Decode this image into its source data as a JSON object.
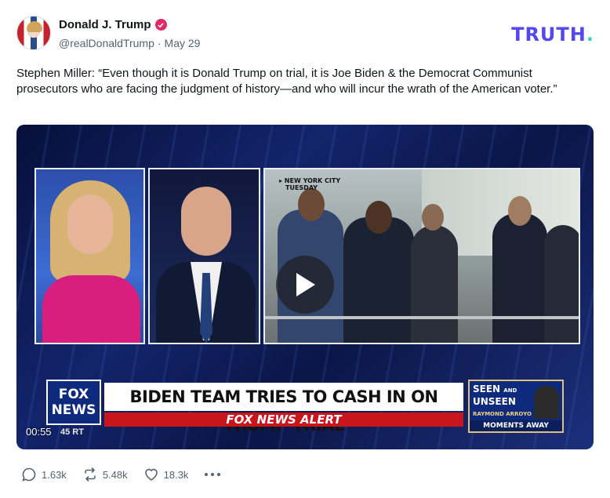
{
  "post": {
    "author": {
      "display_name": "Donald J. Trump",
      "handle": "@realDonaldTrump",
      "separator": "·",
      "date": "May 29",
      "verified_icon": "verified-badge-icon",
      "verified_color": "#e02a63"
    },
    "brand": {
      "logo_text": "TRUTH",
      "logo_dot": ".",
      "logo_color": "#5448ee",
      "dot_color": "#2fd4c4"
    },
    "text": "Stephen Miller: “Even though it is Donald Trump on trial, it is Joe Biden & the Democrat Communist prosecutors who are facing the judgment of history—and who will incur the wrath of the American voter.”",
    "video": {
      "timestamp": "00:55",
      "ticker_fragment": "45 RT",
      "location_line1": "▸ NEW YORK CITY",
      "location_line2": "TUESDAY",
      "network_line1": "FOX",
      "network_line2": "NEWS",
      "headline": "BIDEN TEAM TRIES TO CASH IN ON TRUMP TRIAL",
      "alert": "FOX NEWS ALERT",
      "promo_title_1": "SEEN",
      "promo_and": "AND",
      "promo_title_2": "UNSEEN",
      "promo_subject": "RAYMOND ARROYO",
      "promo_moments": "MOMENTS AWAY",
      "play_icon": "play-icon"
    },
    "stats": {
      "replies": "1.63k",
      "retruths": "5.48k",
      "likes": "18.3k",
      "reply_icon": "reply-icon",
      "retruth_icon": "retruth-icon",
      "like_icon": "heart-icon",
      "more_icon": "more-icon"
    }
  }
}
